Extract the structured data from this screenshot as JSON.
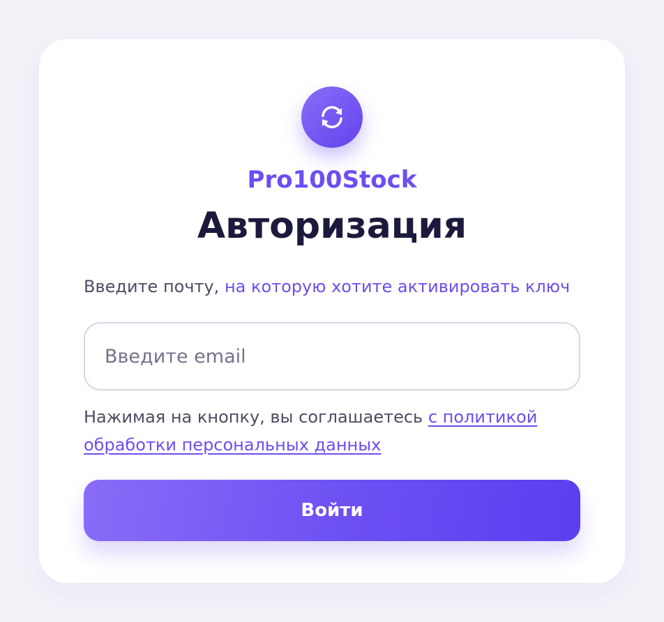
{
  "brand": {
    "name": "Pro100Stock",
    "logo_icon": "refresh-icon",
    "accent_color": "#6d4ef0"
  },
  "auth": {
    "title": "Авторизация",
    "subtitle_plain": "Введите почту, ",
    "subtitle_accent": "на которую хотите активировать ключ",
    "email_placeholder": "Введите email",
    "email_value": "",
    "consent_text": "Нажимая на кнопку, вы соглашаетесь ",
    "consent_link": "с политикой обработки персональных данных",
    "submit_label": "Войти"
  }
}
